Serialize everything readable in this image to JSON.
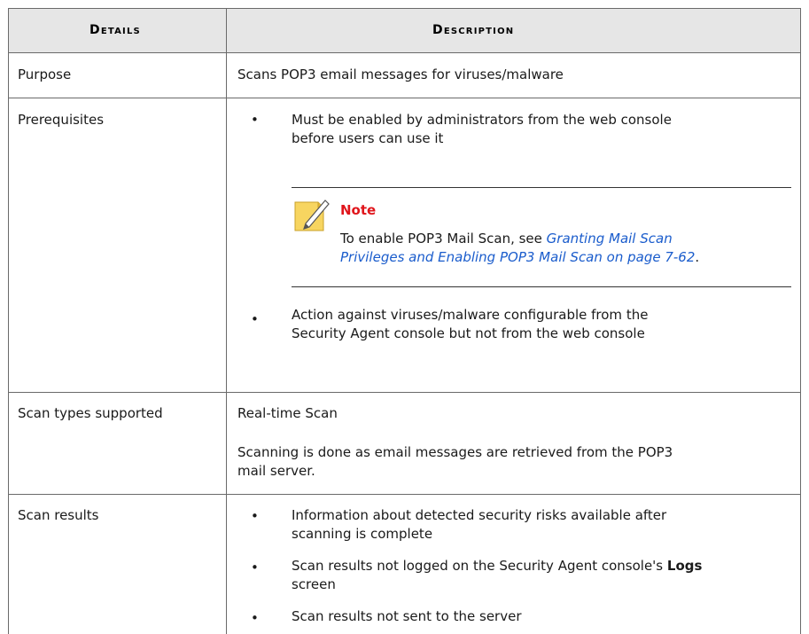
{
  "table": {
    "header": {
      "col1": "Details",
      "col2": "Description"
    },
    "rows": [
      {
        "detail": "Purpose",
        "description": "Scans POP3 email messages for viruses/malware"
      },
      {
        "detail": "Prerequisites",
        "bullet1_line1": "Must be enabled by administrators from the web console",
        "bullet1_line2": "before users can use it",
        "note": {
          "title": "Note",
          "line1_prefix": "To enable POP3 Mail Scan, see ",
          "line1_link": "Granting Mail Scan",
          "line2_link": "Privileges and Enabling POP3 Mail Scan on page 7-62",
          "line2_suffix": "."
        },
        "bullet2_line1": "Action against viruses/malware configurable from the",
        "bullet2_line2": "Security Agent console but not from the web console"
      },
      {
        "detail": "Scan types supported",
        "para1": "Real-time Scan",
        "para2_line1": "Scanning is done as email messages are retrieved from the POP3",
        "para2_line2": "mail server."
      },
      {
        "detail": "Scan results",
        "bullet1_line1": "Information about detected security risks available after",
        "bullet1_line2": "scanning is complete",
        "bullet2_line1_prefix": "Scan results not logged on the Security Agent console's ",
        "bullet2_line1_bold": "Logs",
        "bullet2_line2": "screen",
        "bullet3_line1": "Scan results not sent to the server"
      }
    ],
    "bullet_char": "•"
  }
}
